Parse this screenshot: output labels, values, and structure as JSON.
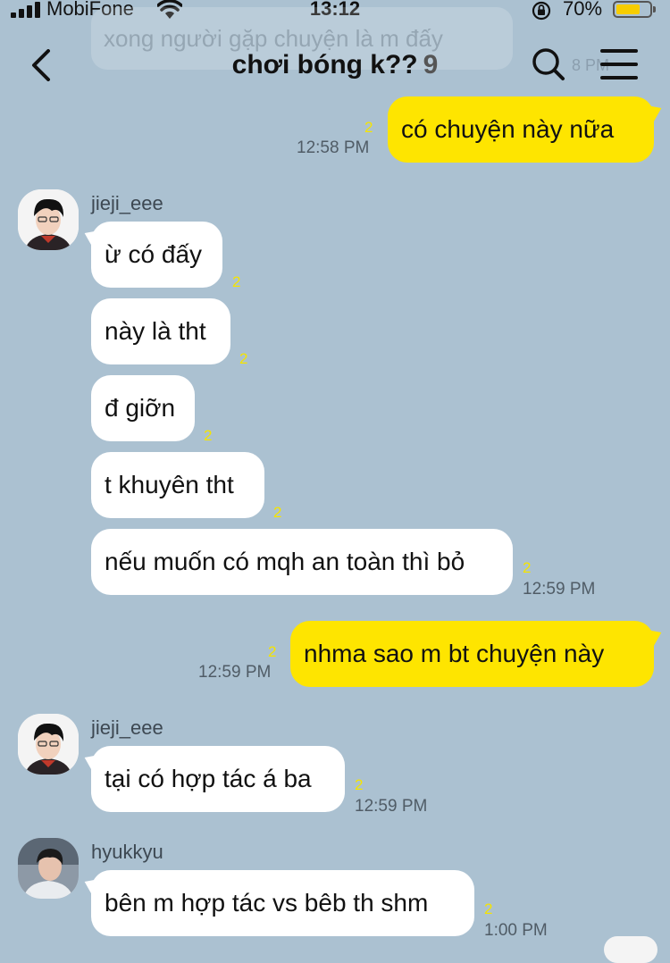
{
  "status_bar": {
    "carrier": "MobiFone",
    "time": "13:12",
    "battery_percent": "70%",
    "battery_level": 0.7
  },
  "header": {
    "title": "chơi bóng k??",
    "member_count": "9",
    "background_preview_text": "xong người gặp chuyện là m đấy",
    "background_preview_time": "8 PM"
  },
  "users": {
    "a": "jieji_eee",
    "b": "hyukkyu"
  },
  "messages": [
    {
      "text": "có chuyện này nữa",
      "unread": "2",
      "time": "12:58 PM"
    },
    {
      "text": "ừ có đấy",
      "unread": "2"
    },
    {
      "text": "này là tht",
      "unread": "2"
    },
    {
      "text": "đ giỡn",
      "unread": "2"
    },
    {
      "text": "t khuyên tht",
      "unread": "2"
    },
    {
      "text": "nếu muốn có mqh an toàn thì bỏ",
      "unread": "2",
      "time": "12:59 PM"
    },
    {
      "text": "nhma sao m bt chuyện này",
      "unread": "2",
      "time": "12:59 PM"
    },
    {
      "text": "tại có hợp tác á ba",
      "unread": "2",
      "time": "12:59 PM"
    },
    {
      "text": "bên m hợp tác vs bêb th shm",
      "unread": "2",
      "time": "1:00 PM"
    }
  ],
  "colors": {
    "background": "#abc1d1",
    "my_bubble": "#fee500",
    "their_bubble": "#ffffff",
    "unread_count": "#f5e400"
  }
}
